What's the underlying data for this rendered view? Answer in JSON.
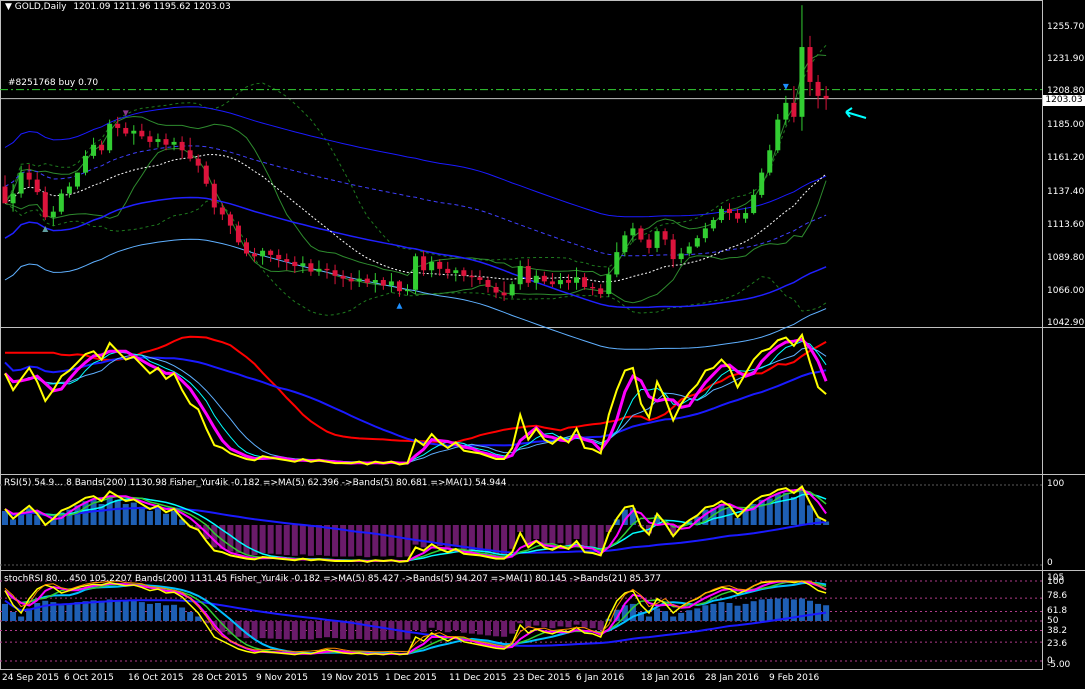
{
  "header": {
    "symbol_title": "GOLD,Daily",
    "ohlc": "1201.09 1211.96 1195.62 1203.03",
    "order_label": "#8251768 buy 0.70"
  },
  "price_axis": {
    "labels": [
      "1255.70",
      "1231.90",
      "1208.80",
      "1185.00",
      "1161.20",
      "1137.40",
      "1113.60",
      "1089.80",
      "1066.00",
      "1042.90"
    ],
    "current_price": "1203.03"
  },
  "rsi_panel": {
    "label": "RSI(5) 54.9… 8  Bands(200) 1130.98  Fisher_Yur4ik -0.182  =>MA(5) 62.396  ->Bands(5) 80.681  =>MA(1) 54.944",
    "levels": [
      "100",
      "0"
    ]
  },
  "stoch_panel": {
    "label": "stochRSI 80.…450 105.2207  Bands(200) 1131.45  Fisher_Yur4ik -0.182  =>MA(5) 85.427  ->Bands(5) 94.207  =>MA(1) 80.145  ->Bands(21) 85.377",
    "levels": [
      "105",
      "100",
      "78.6",
      "61.8",
      "50",
      "38.2",
      "23.6",
      "0",
      "-5.00"
    ]
  },
  "time_axis": {
    "labels": [
      "24 Sep 2015",
      "6 Oct 2015",
      "16 Oct 2015",
      "28 Oct 2015",
      "9 Nov 2015",
      "19 Nov 2015",
      "1 Dec 2015",
      "11 Dec 2015",
      "23 Dec 2015",
      "6 Jan 2016",
      "18 Jan 2016",
      "28 Jan 2016",
      "9 Feb 2016"
    ]
  },
  "colors": {
    "background": "#000000",
    "bull_candle": "#32cd32",
    "bear_candle": "#dc143c",
    "rsi_line": "#ffff00",
    "signal_red": "#ff0000",
    "band_blue": "#0000ff",
    "cyan": "#00ffff",
    "magenta": "#ff00ff",
    "histogram_up": "#1e5fb4",
    "histogram_down": "#6a1b6a"
  },
  "chart_data": {
    "type": "candlestick",
    "symbol": "GOLD",
    "timeframe": "Daily",
    "open": [
      1140,
      1128,
      1135,
      1150,
      1145,
      1136,
      1118,
      1122,
      1135,
      1140,
      1150,
      1162,
      1170,
      1166,
      1185,
      1182,
      1178,
      1180,
      1176,
      1172,
      1174,
      1170,
      1172,
      1166,
      1160,
      1155,
      1142,
      1125,
      1120,
      1112,
      1100,
      1092,
      1090,
      1094,
      1091,
      1088,
      1086,
      1083,
      1085,
      1079,
      1081,
      1080,
      1076,
      1074,
      1072,
      1074,
      1071,
      1073,
      1069,
      1072,
      1065,
      1066,
      1090,
      1080,
      1086,
      1081,
      1078,
      1080,
      1076,
      1075,
      1073,
      1068,
      1064,
      1062,
      1070,
      1083,
      1071,
      1076,
      1072,
      1070,
      1073,
      1071,
      1075,
      1068,
      1067,
      1063,
      1077,
      1093,
      1105,
      1110,
      1102,
      1096,
      1108,
      1102,
      1088,
      1092,
      1097,
      1103,
      1110,
      1116,
      1124,
      1121,
      1117,
      1121,
      1134,
      1150,
      1166,
      1188,
      1200,
      1190,
      1240,
      1215,
      1205
    ],
    "high": [
      1148,
      1142,
      1155,
      1156,
      1150,
      1140,
      1126,
      1138,
      1143,
      1150,
      1166,
      1175,
      1173,
      1188,
      1190,
      1186,
      1184,
      1185,
      1180,
      1178,
      1178,
      1175,
      1176,
      1175,
      1163,
      1158,
      1145,
      1128,
      1122,
      1115,
      1103,
      1096,
      1096,
      1095,
      1095,
      1092,
      1090,
      1090,
      1088,
      1087,
      1085,
      1084,
      1080,
      1078,
      1080,
      1077,
      1078,
      1075,
      1078,
      1073,
      1070,
      1092,
      1094,
      1090,
      1088,
      1086,
      1082,
      1082,
      1080,
      1080,
      1075,
      1071,
      1072,
      1072,
      1087,
      1088,
      1080,
      1079,
      1078,
      1078,
      1077,
      1082,
      1078,
      1071,
      1070,
      1082,
      1100,
      1108,
      1114,
      1112,
      1106,
      1110,
      1110,
      1106,
      1096,
      1100,
      1105,
      1114,
      1118,
      1126,
      1128,
      1124,
      1125,
      1138,
      1153,
      1170,
      1192,
      1205,
      1212,
      1270,
      1248,
      1220,
      1212
    ],
    "low": [
      1130,
      1122,
      1132,
      1140,
      1134,
      1116,
      1112,
      1120,
      1132,
      1138,
      1148,
      1160,
      1163,
      1164,
      1176,
      1176,
      1170,
      1174,
      1168,
      1168,
      1166,
      1166,
      1160,
      1158,
      1150,
      1140,
      1120,
      1116,
      1106,
      1098,
      1090,
      1086,
      1084,
      1086,
      1082,
      1080,
      1078,
      1078,
      1076,
      1076,
      1074,
      1070,
      1068,
      1066,
      1068,
      1068,
      1064,
      1066,
      1064,
      1061,
      1062,
      1063,
      1076,
      1075,
      1076,
      1074,
      1072,
      1072,
      1068,
      1070,
      1064,
      1060,
      1058,
      1060,
      1066,
      1068,
      1066,
      1070,
      1068,
      1067,
      1066,
      1066,
      1066,
      1062,
      1060,
      1061,
      1075,
      1090,
      1100,
      1100,
      1092,
      1093,
      1098,
      1082,
      1085,
      1090,
      1096,
      1100,
      1108,
      1114,
      1116,
      1114,
      1114,
      1120,
      1132,
      1148,
      1164,
      1184,
      1186,
      1180,
      1205,
      1196,
      1195
    ],
    "close": [
      1128,
      1135,
      1150,
      1145,
      1136,
      1118,
      1122,
      1135,
      1140,
      1150,
      1162,
      1170,
      1166,
      1185,
      1182,
      1178,
      1180,
      1176,
      1172,
      1174,
      1170,
      1172,
      1166,
      1160,
      1155,
      1142,
      1125,
      1120,
      1112,
      1100,
      1092,
      1090,
      1094,
      1091,
      1088,
      1086,
      1083,
      1085,
      1079,
      1081,
      1080,
      1076,
      1074,
      1072,
      1074,
      1071,
      1073,
      1069,
      1072,
      1065,
      1066,
      1090,
      1080,
      1086,
      1081,
      1078,
      1080,
      1076,
      1075,
      1073,
      1068,
      1064,
      1062,
      1070,
      1083,
      1071,
      1076,
      1072,
      1070,
      1073,
      1071,
      1075,
      1068,
      1067,
      1063,
      1077,
      1093,
      1105,
      1110,
      1102,
      1096,
      1108,
      1102,
      1088,
      1092,
      1097,
      1103,
      1110,
      1116,
      1124,
      1121,
      1117,
      1121,
      1134,
      1150,
      1166,
      1188,
      1200,
      1190,
      1240,
      1215,
      1205,
      1203
    ],
    "ylim": [
      1042.9,
      1268
    ],
    "xlabels": [
      "24 Sep 2015",
      "6 Oct 2015",
      "16 Oct 2015",
      "28 Oct 2015",
      "9 Nov 2015",
      "19 Nov 2015",
      "1 Dec 2015",
      "11 Dec 2015",
      "23 Dec 2015",
      "6 Jan 2016",
      "18 Jan 2016",
      "28 Jan 2016",
      "9 Feb 2016"
    ],
    "order_level": 1209.5,
    "rsi": {
      "ylim": [
        0,
        100
      ],
      "rsi_line": [
        70,
        58,
        66,
        74,
        64,
        50,
        58,
        68,
        72,
        78,
        84,
        86,
        80,
        92,
        86,
        80,
        82,
        76,
        70,
        74,
        66,
        70,
        58,
        48,
        44,
        30,
        18,
        16,
        12,
        10,
        8,
        7,
        10,
        9,
        8,
        7,
        6,
        8,
        6,
        7,
        6,
        5,
        5,
        5,
        6,
        4,
        6,
        5,
        6,
        4,
        5,
        22,
        18,
        26,
        20,
        16,
        20,
        14,
        13,
        12,
        10,
        8,
        8,
        16,
        40,
        22,
        30,
        22,
        19,
        24,
        20,
        30,
        16,
        15,
        12,
        40,
        58,
        72,
        74,
        48,
        38,
        64,
        52,
        36,
        48,
        56,
        62,
        72,
        74,
        80,
        74,
        60,
        70,
        80,
        86,
        88,
        94,
        96,
        90,
        98,
        78,
        60,
        55
      ]
    },
    "stoch": {
      "ylim": [
        -5,
        105
      ],
      "stoch_line": [
        88,
        70,
        60,
        78,
        90,
        95,
        92,
        85,
        88,
        92,
        94,
        96,
        95,
        98,
        96,
        94,
        95,
        92,
        88,
        90,
        85,
        86,
        80,
        70,
        60,
        45,
        30,
        25,
        20,
        15,
        12,
        10,
        12,
        11,
        10,
        9,
        8,
        10,
        9,
        12,
        14,
        12,
        10,
        9,
        10,
        8,
        9,
        8,
        10,
        8,
        9,
        30,
        25,
        35,
        30,
        25,
        30,
        24,
        22,
        20,
        18,
        16,
        15,
        22,
        45,
        35,
        40,
        36,
        34,
        38,
        36,
        42,
        35,
        34,
        30,
        55,
        75,
        85,
        88,
        70,
        60,
        78,
        72,
        60,
        68,
        74,
        78,
        85,
        88,
        92,
        90,
        84,
        88,
        94,
        98,
        99,
        100,
        100,
        98,
        100,
        95,
        88,
        85
      ]
    }
  }
}
